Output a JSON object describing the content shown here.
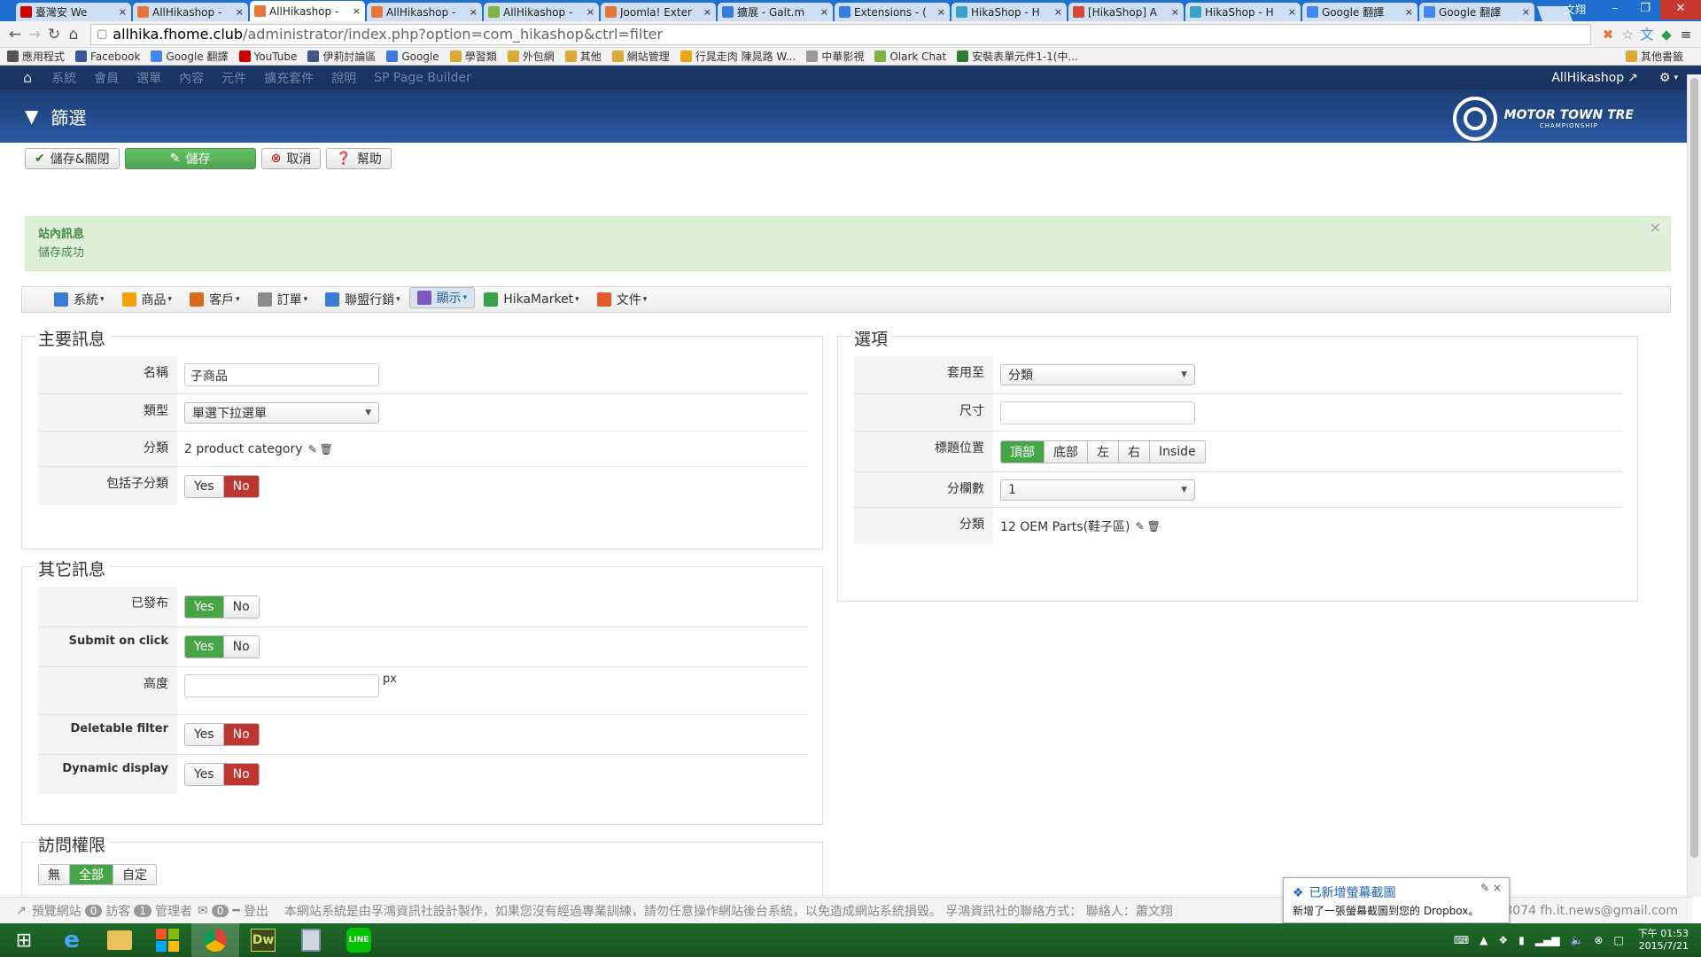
{
  "browser": {
    "tabs": [
      {
        "title": "臺灣安 We",
        "icon": "youtube-icon",
        "color": "#cc0000",
        "active": false
      },
      {
        "title": "AllHikashop -",
        "icon": "joomla-icon",
        "color": "#e2783c",
        "active": false
      },
      {
        "title": "AllHikashop -",
        "icon": "joomla-icon",
        "color": "#e2783c",
        "active": true
      },
      {
        "title": "AllHikashop -",
        "icon": "joomla-icon",
        "color": "#e2783c",
        "active": false
      },
      {
        "title": "AllHikashop -",
        "icon": "leaf-icon",
        "color": "#7cb342",
        "active": false
      },
      {
        "title": "Joomla! Exter",
        "icon": "joomla-icon",
        "color": "#e2783c",
        "active": false
      },
      {
        "title": "擴展 - Galt.m",
        "icon": "g-icon",
        "color": "#3b7ddd",
        "active": false
      },
      {
        "title": "Extensions - (",
        "icon": "g-icon",
        "color": "#3b7ddd",
        "active": false
      },
      {
        "title": "HikaShop - H",
        "icon": "hikashop-icon",
        "color": "#3aa0c8",
        "active": false
      },
      {
        "title": "[HikaShop] A",
        "icon": "gmail-icon",
        "color": "#d44638",
        "active": false
      },
      {
        "title": "HikaShop - H",
        "icon": "hikashop-icon",
        "color": "#3aa0c8",
        "active": false
      },
      {
        "title": "Google 翻譯",
        "icon": "translate-icon",
        "color": "#4285f4",
        "active": false
      },
      {
        "title": "Google 翻譯",
        "icon": "translate-icon",
        "color": "#4285f4",
        "active": false
      }
    ],
    "window_user": "文翔",
    "url_host": "allhika.fhome.club",
    "url_path": "/administrator/index.php?option=com_hikashop&ctrl=filter",
    "bookmarks": [
      {
        "label": "應用程式",
        "icon": "apps-icon",
        "color": "#555555"
      },
      {
        "label": "Facebook",
        "icon": "facebook-icon",
        "color": "#3b5998"
      },
      {
        "label": "Google 翻譯",
        "icon": "translate-icon",
        "color": "#4285f4"
      },
      {
        "label": "YouTube",
        "icon": "youtube-icon",
        "color": "#cc0000"
      },
      {
        "label": "伊莉討論區",
        "icon": "e-icon",
        "color": "#445588"
      },
      {
        "label": "Google",
        "icon": "g-icon",
        "color": "#3b7ddd"
      },
      {
        "label": "學習類",
        "icon": "folder-icon",
        "color": "#d9a93a"
      },
      {
        "label": "外包網",
        "icon": "folder-icon",
        "color": "#d9a93a"
      },
      {
        "label": "其他",
        "icon": "folder-icon",
        "color": "#d9a93a"
      },
      {
        "label": "網站管理",
        "icon": "folder-icon",
        "color": "#d9a93a"
      },
      {
        "label": "行晁走肉 陳晁路 W...",
        "icon": "star-icon",
        "color": "#e6a817"
      },
      {
        "label": "中華影視",
        "icon": "page-icon",
        "color": "#999999"
      },
      {
        "label": "Olark Chat",
        "icon": "dot-icon",
        "color": "#7cb342"
      },
      {
        "label": "安裝表單元件1-1(中...",
        "icon": "form-icon",
        "color": "#2e7d32"
      }
    ],
    "bookmarks_other": "其他書籤"
  },
  "admin_menu": {
    "items": [
      "系統",
      "會員",
      "選單",
      "內容",
      "元件",
      "擴充套件",
      "說明",
      "SP Page Builder"
    ],
    "site_link": "AllHikashop"
  },
  "header": {
    "title": "篩選",
    "logo_line1": "MOTOR TOWN TRE",
    "logo_line2": "CHAMPIONSHIP"
  },
  "toolbar": {
    "save_close": "儲存&關閉",
    "save": "儲存",
    "cancel": "取消",
    "help": "幫助"
  },
  "message": {
    "heading": "站內訊息",
    "text": "儲存成功"
  },
  "hika_menu": {
    "items": [
      {
        "label": "系統",
        "icon": "tools-icon",
        "color": "#3a7bd5"
      },
      {
        "label": "商品",
        "icon": "product-icon",
        "color": "#f0a30a"
      },
      {
        "label": "客戶",
        "icon": "customer-icon",
        "color": "#d86a1e"
      },
      {
        "label": "訂單",
        "icon": "order-icon",
        "color": "#8a8a8a"
      },
      {
        "label": "聯盟行銷",
        "icon": "affiliate-icon",
        "color": "#3a7bd5"
      },
      {
        "label": "顯示",
        "icon": "display-icon",
        "color": "#7e57c2"
      },
      {
        "label": "HikaMarket",
        "icon": "hikamarket-icon",
        "color": "#3aa04a"
      },
      {
        "label": "文件",
        "icon": "docs-icon",
        "color": "#e35d2a"
      }
    ],
    "selected_index": 5
  },
  "main_info": {
    "legend": "主要訊息",
    "name_label": "名稱",
    "name_value": "子商品",
    "type_label": "類型",
    "type_value": "單選下拉選單",
    "category_label": "分類",
    "category_value": "2 product category",
    "include_sub_label": "包括子分類",
    "include_sub_value": "No"
  },
  "other_info": {
    "legend": "其它訊息",
    "published_label": "已發布",
    "published_value": "Yes",
    "submit_label": "Submit on click",
    "submit_value": "Yes",
    "height_label": "高度",
    "height_value": "",
    "height_unit": "px",
    "deletable_label": "Deletable filter",
    "deletable_value": "No",
    "dynamic_label": "Dynamic display",
    "dynamic_value": "No"
  },
  "access": {
    "legend": "訪問權限",
    "options": [
      "無",
      "全部",
      "自定"
    ],
    "selected": "全部"
  },
  "options": {
    "legend": "選項",
    "apply_label": "套用至",
    "apply_value": "分類",
    "size_label": "尺寸",
    "size_value": "",
    "title_pos_label": "標題位置",
    "title_pos_options": [
      "頂部",
      "底部",
      "左",
      "右",
      "Inside"
    ],
    "title_pos_selected": "頂部",
    "columns_label": "分欄數",
    "columns_value": "1",
    "category_label": "分類",
    "category_value": "12 OEM Parts(鞋子區)"
  },
  "yes": "Yes",
  "no": "No",
  "footer": {
    "preview": "預覽網站",
    "visitors_count": "0",
    "visitors": "訪客",
    "admins_count": "1",
    "admins": "管理者",
    "messages_count": "0",
    "logout": "登出",
    "notice": "本網站系統是由孚鴻資訊社設計製作，如果您沒有經過專業訓練，請勿任意操作網站後台系統，以免造成網站系統損毀。 孚鴻資訊社的聯絡方式： 聯絡人：蕭文翔",
    "contact_tail": "1-3074 fh.it.news@gmail.com"
  },
  "toast": {
    "title": "已新增螢幕截圖",
    "text": "新增了一張螢幕截圖到您的 Dropbox。"
  },
  "taskbar": {
    "time": "下午 01:53",
    "date": "2015/7/21"
  },
  "colors": {
    "admin_bar": "#17325e",
    "header": "#2a5aa5",
    "green": "#46a546",
    "red": "#bd362f",
    "message_bg": "#dff0d8"
  }
}
